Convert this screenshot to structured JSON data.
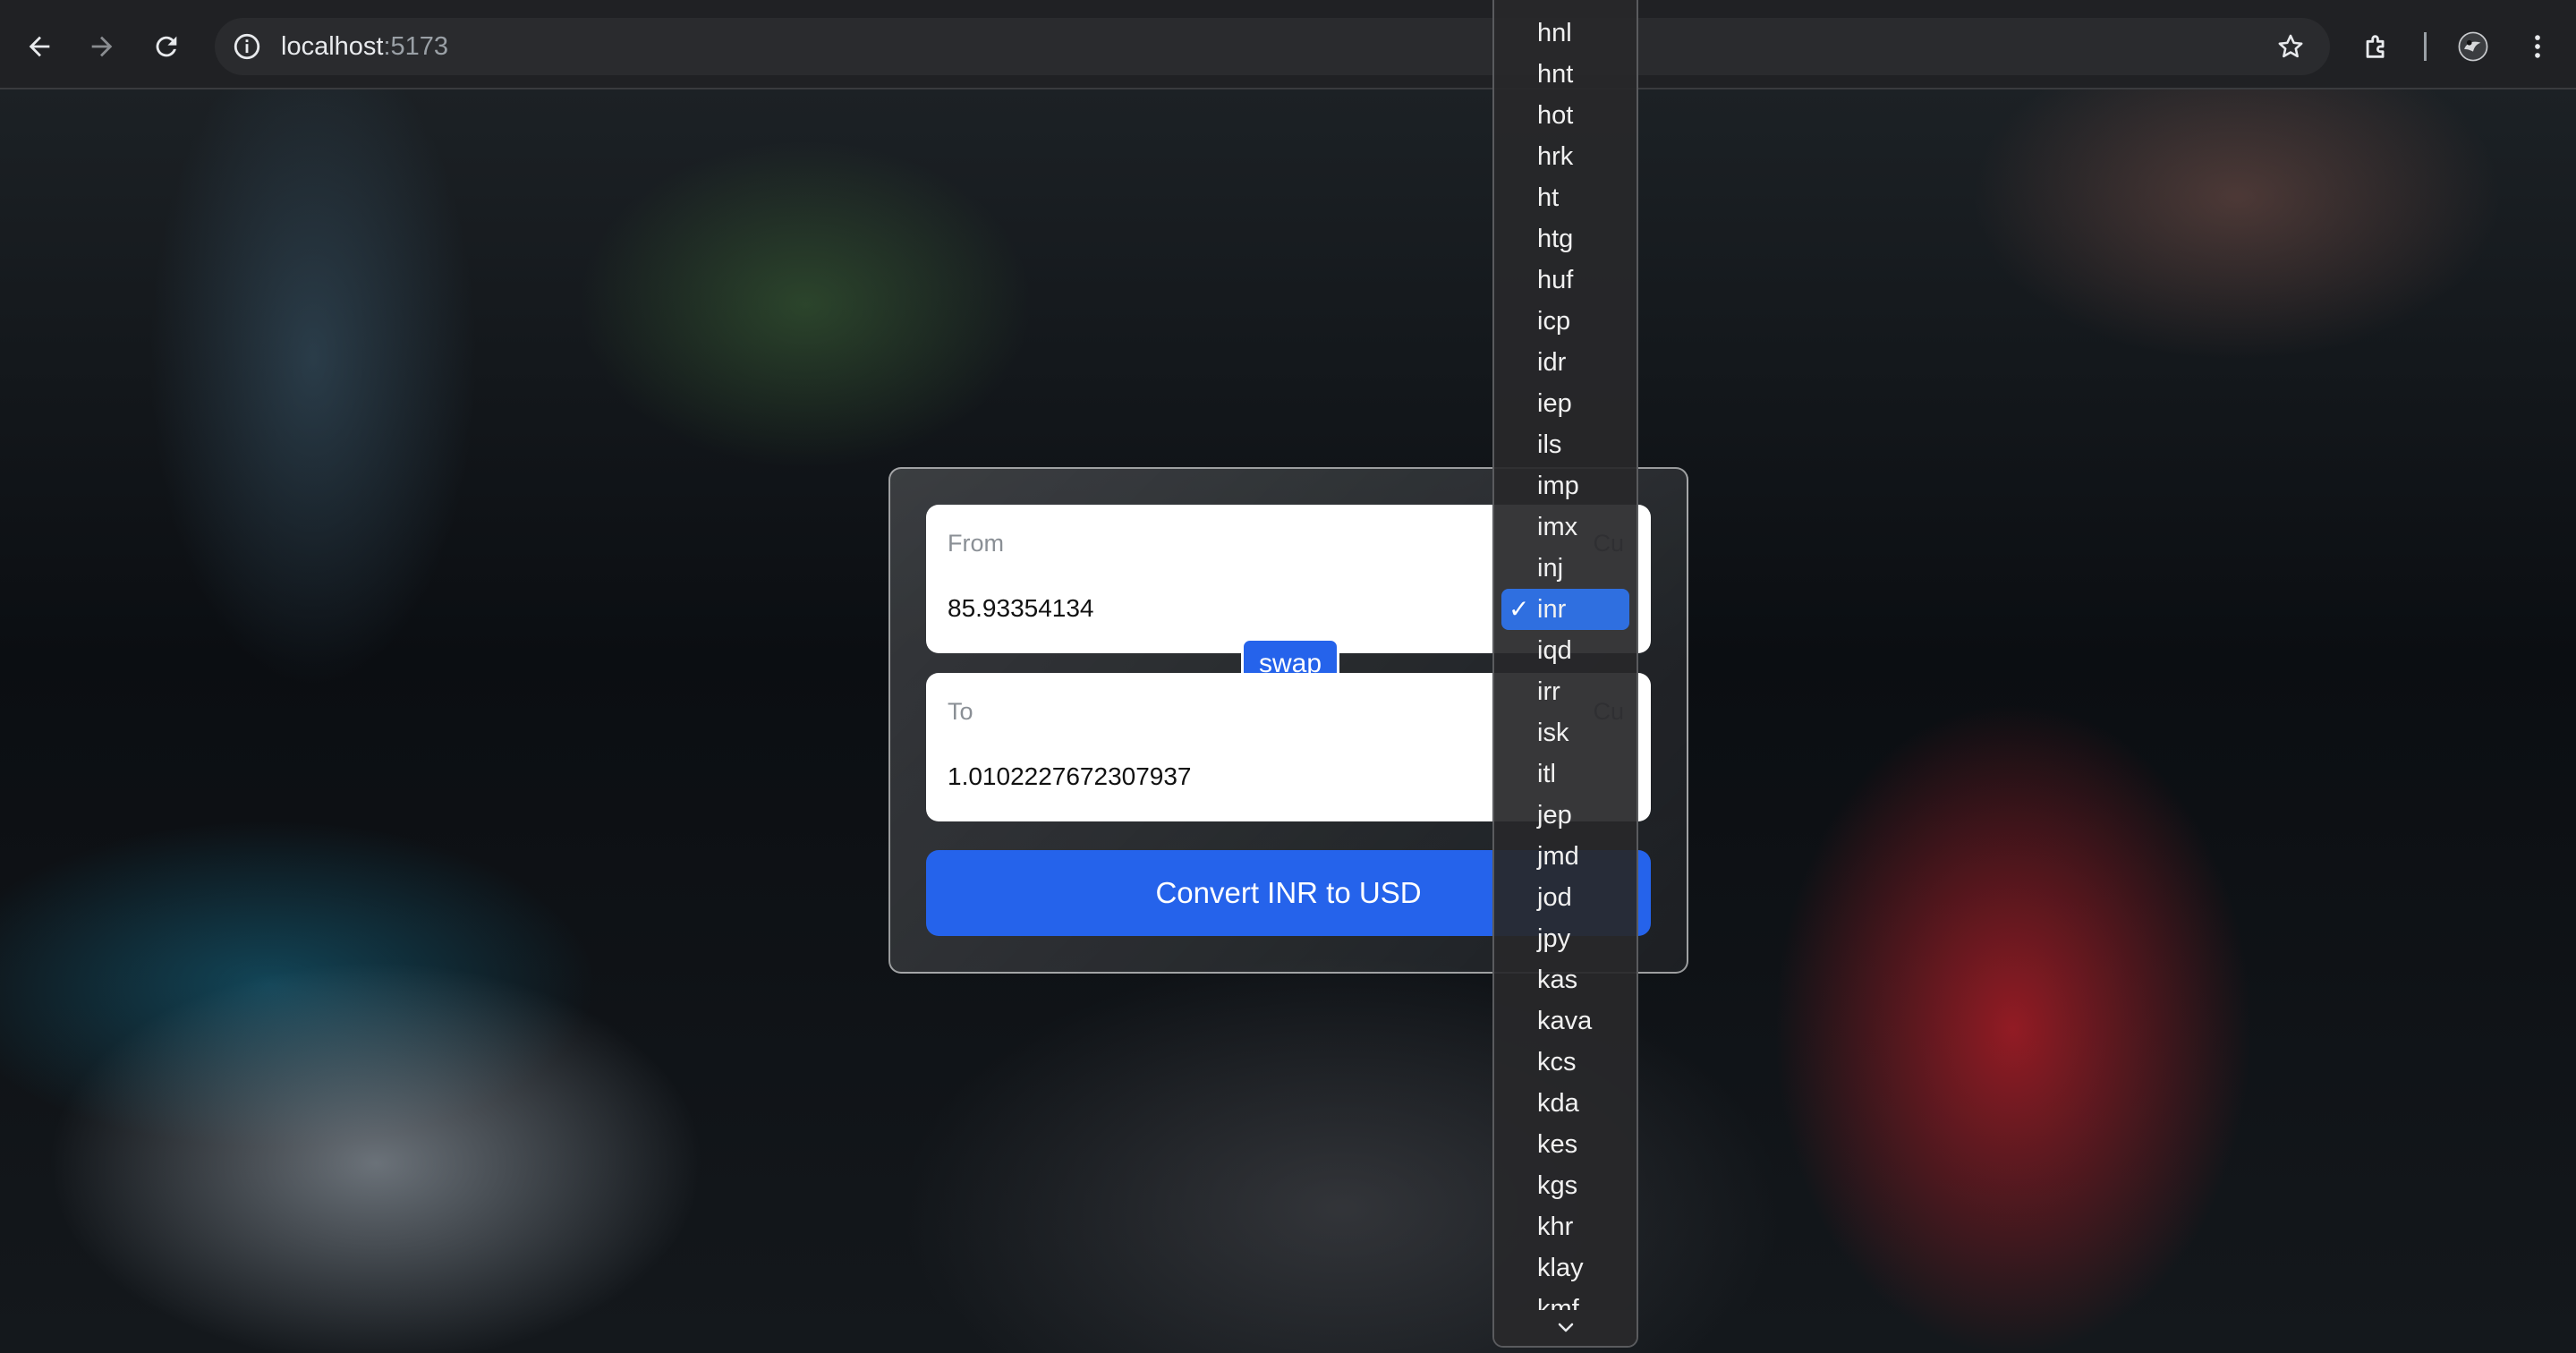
{
  "browser": {
    "url_host": "localhost",
    "url_port": ":5173",
    "icons": [
      "back-arrow-icon",
      "forward-arrow-icon",
      "reload-icon",
      "site-info-icon",
      "bookmark-star-icon",
      "extensions-icon",
      "profile-avatar",
      "kebab-menu-icon"
    ]
  },
  "converter": {
    "from": {
      "label": "From",
      "currency_label": "Cu",
      "amount": "85.93354134"
    },
    "to": {
      "label": "To",
      "currency_label": "Cu",
      "amount": "1.0102227672307937"
    },
    "swap_label": "swap",
    "convert_label": "Convert INR to USD"
  },
  "currency_dropdown": {
    "selected": "inr",
    "check_mark": "✓",
    "options": [
      "hnl",
      "hnt",
      "hot",
      "hrk",
      "ht",
      "htg",
      "huf",
      "icp",
      "idr",
      "iep",
      "ils",
      "imp",
      "imx",
      "inj",
      "inr",
      "iqd",
      "irr",
      "isk",
      "itl",
      "jep",
      "jmd",
      "jod",
      "jpy",
      "kas",
      "kava",
      "kcs",
      "kda",
      "kes",
      "kgs",
      "khr",
      "klay",
      "kmf"
    ]
  },
  "colors": {
    "accent": "#2563eb",
    "selection": "#2f6fe0",
    "chrome_bg": "#202124"
  }
}
